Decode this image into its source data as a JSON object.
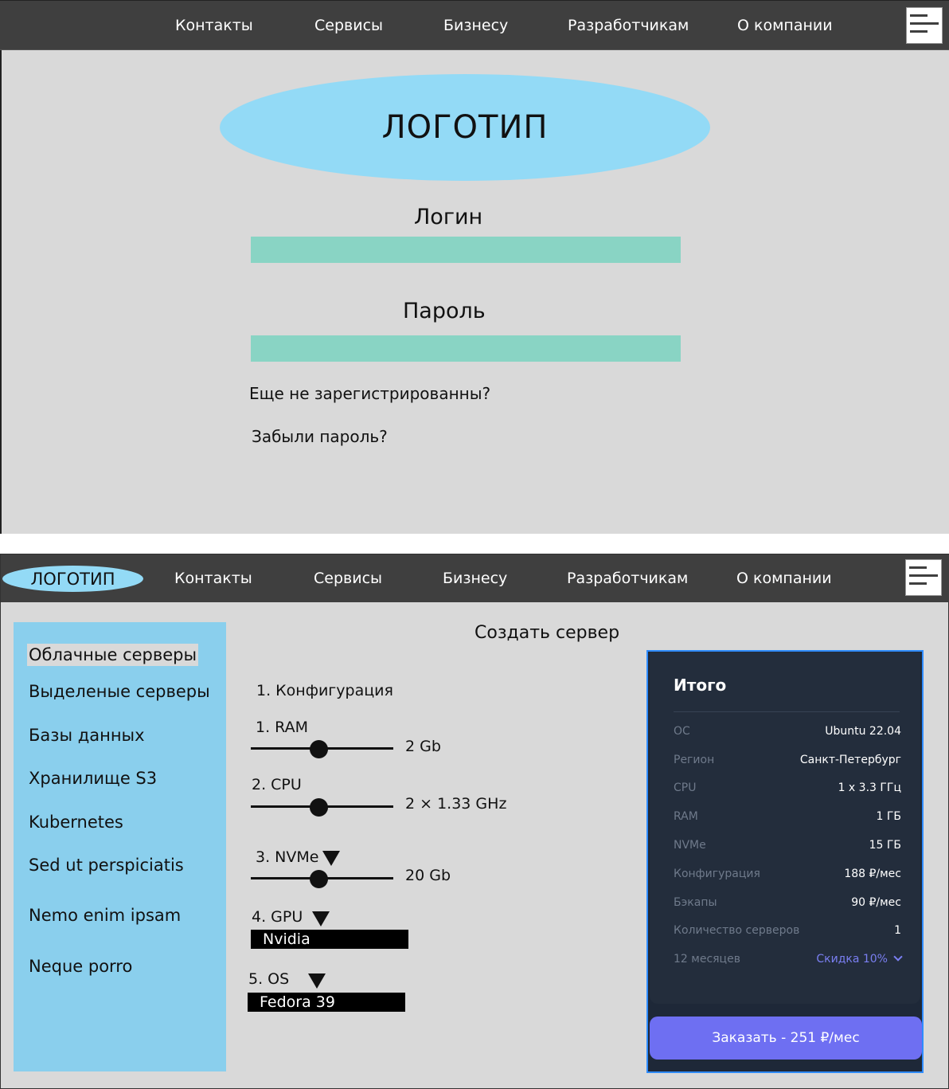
{
  "nav": {
    "items": [
      "Контакты",
      "Сервисы",
      "Бизнесу",
      "Разработчикам",
      "О компании"
    ]
  },
  "login_page": {
    "logo": "ЛОГОТИП",
    "login_label": "Логин",
    "password_label": "Пароль",
    "register_link": "Еще не зарегистрированны?",
    "forgot_link": "Забыли пароль?"
  },
  "server_page": {
    "logo": "ЛОГОТИП",
    "sidebar": {
      "items": [
        "Облачные серверы",
        "Выделеные серверы",
        "Базы данных",
        "Хранилище S3",
        "Kubernetes",
        "Sed ut perspiciatis",
        "Nemo enim ipsam",
        "Neque porro"
      ],
      "active_index": 0
    },
    "title": "Создать сервер",
    "config": {
      "heading": "1. Конфигурация",
      "ram_label": "1. RAM",
      "ram_value": "2 Gb",
      "cpu_label": "2. CPU",
      "cpu_value": "2 × 1.33 GHz",
      "nvme_label": "3. NVMe",
      "nvme_value": "20 Gb",
      "gpu_label": "4. GPU",
      "gpu_selected": "Nvidia",
      "os_label": "5. OS",
      "os_selected": "Fedora 39"
    },
    "summary": {
      "title": "Итого",
      "rows": [
        {
          "k": "ОС",
          "v": "Ubuntu 22.04"
        },
        {
          "k": "Регион",
          "v": "Санкт-Петербург"
        },
        {
          "k": "CPU",
          "v": "1 x 3.3 ГГц"
        },
        {
          "k": "RAM",
          "v": "1 ГБ"
        },
        {
          "k": "NVMe",
          "v": "15 ГБ"
        },
        {
          "k": "Конфигурация",
          "v": "188 ₽/мес"
        },
        {
          "k": "Бэкапы",
          "v": "90 ₽/мес"
        },
        {
          "k": "Количество серверов",
          "v": "1"
        },
        {
          "k": "12 месяцев",
          "v": "Скидка 10%"
        }
      ],
      "order_button": "Заказать - 251 ₽/мес"
    }
  },
  "colors": {
    "nav_bg": "#3f3f3f",
    "page_bg": "#d9d9d9",
    "logo_bg": "#93daf6",
    "input_bg": "#89d4c4",
    "sidebar_bg": "#8acfed",
    "summary_bg": "#232d3c",
    "accent": "#6e6ff2"
  },
  "icons": {
    "menu": "hamburger-menu-icon",
    "dropdown": "triangle-down-icon",
    "discount": "chevron-down-icon"
  }
}
